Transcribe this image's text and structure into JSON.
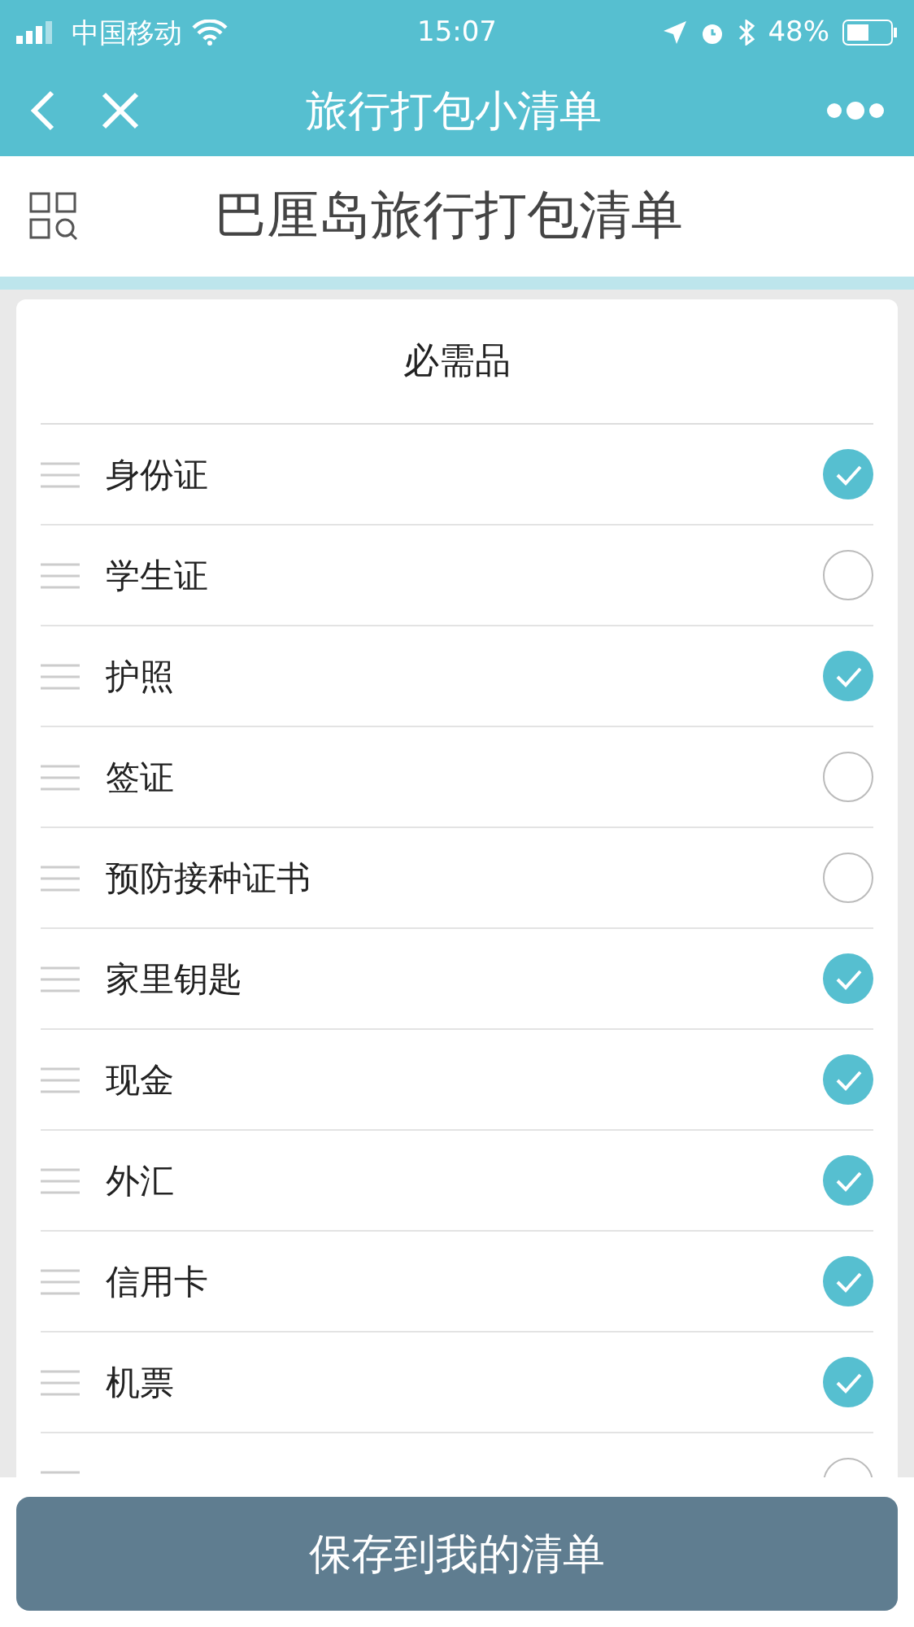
{
  "status_bar": {
    "carrier": "中国移动",
    "time": "15:07",
    "battery": "48%"
  },
  "nav": {
    "title": "旅行打包小清单"
  },
  "header": {
    "title": "巴厘岛旅行打包清单"
  },
  "section": {
    "title": "必需品",
    "items": [
      {
        "label": "身份证",
        "checked": true
      },
      {
        "label": "学生证",
        "checked": false
      },
      {
        "label": "护照",
        "checked": true
      },
      {
        "label": "签证",
        "checked": false
      },
      {
        "label": "预防接种证书",
        "checked": false
      },
      {
        "label": "家里钥匙",
        "checked": true
      },
      {
        "label": "现金",
        "checked": true
      },
      {
        "label": "外汇",
        "checked": true
      },
      {
        "label": "信用卡",
        "checked": true
      },
      {
        "label": "机票",
        "checked": true
      }
    ],
    "partial_row": {
      "checked": false
    }
  },
  "save_button": "保存到我的清单"
}
